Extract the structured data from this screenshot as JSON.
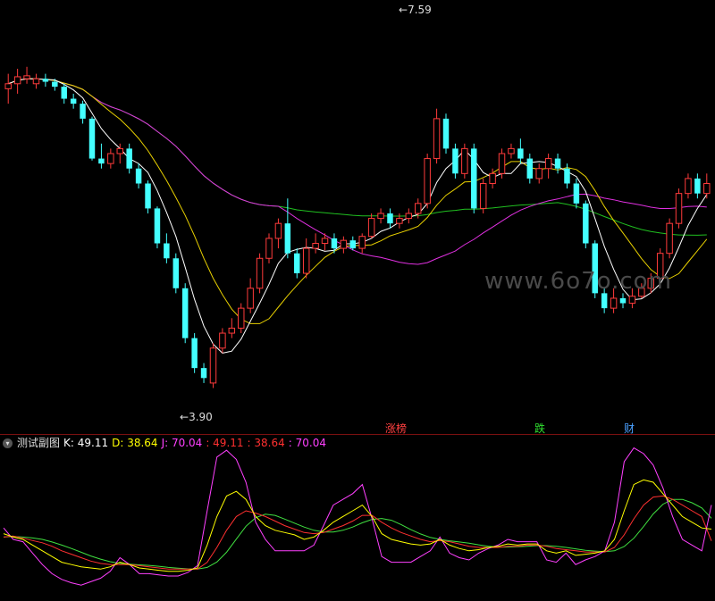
{
  "watermark": "www.6o7o.com",
  "price_labels": {
    "high": "7.59",
    "low": "3.90"
  },
  "tags": [
    {
      "text": "涨榜",
      "color": "#ff4040"
    },
    {
      "text": "跌",
      "color": "#30e030"
    },
    {
      "text": "财",
      "color": "#4aa0ff"
    }
  ],
  "legend": {
    "indicator_name": "测试副图",
    "k_text": "K: 49.11",
    "d_text": "D: 38.64",
    "j_text": "J: 70.04",
    "v1": ": 49.11",
    "v2": ": 38.64",
    "v3": ": 70.04"
  },
  "colors": {
    "up": "#ff3b3b",
    "down": "#44ffff",
    "ma_white": "#ffffff",
    "ma_yellow": "#e8d000",
    "ma_magenta": "#e030e0",
    "ma_green": "#20c020",
    "k_color": "#ffffff",
    "d_color": "#ffff00",
    "j_color": "#ff40ff",
    "v1_color": "#ff3030",
    "v2_color": "#ff3030",
    "v3_color": "#ff40ff"
  },
  "chart_data": [
    {
      "type": "candlestick",
      "title": "",
      "ylim": [
        3.6,
        7.7
      ],
      "annotations": [
        {
          "text": "7.59",
          "value": 7.59
        },
        {
          "text": "3.90",
          "value": 3.9
        }
      ],
      "candles": [
        [
          6.9,
          6.95,
          7.05,
          6.75
        ],
        [
          6.95,
          7.02,
          7.1,
          6.85
        ],
        [
          7.0,
          7.03,
          7.12,
          6.95
        ],
        [
          6.95,
          7.0,
          7.05,
          6.9
        ],
        [
          7.0,
          6.97,
          7.05,
          6.92
        ],
        [
          6.97,
          6.92,
          7.0,
          6.88
        ],
        [
          6.92,
          6.8,
          6.95,
          6.75
        ],
        [
          6.8,
          6.75,
          6.85,
          6.7
        ],
        [
          6.75,
          6.6,
          6.78,
          6.55
        ],
        [
          6.6,
          6.2,
          6.62,
          6.18
        ],
        [
          6.2,
          6.15,
          6.35,
          6.1
        ],
        [
          6.15,
          6.25,
          6.3,
          6.1
        ],
        [
          6.25,
          6.3,
          6.35,
          6.15
        ],
        [
          6.3,
          6.1,
          6.35,
          6.05
        ],
        [
          6.1,
          5.95,
          6.15,
          5.9
        ],
        [
          5.95,
          5.7,
          5.98,
          5.65
        ],
        [
          5.7,
          5.35,
          5.72,
          5.3
        ],
        [
          5.35,
          5.2,
          5.45,
          5.15
        ],
        [
          5.2,
          4.9,
          5.25,
          4.85
        ],
        [
          4.9,
          4.4,
          4.95,
          4.35
        ],
        [
          4.4,
          4.1,
          4.45,
          4.05
        ],
        [
          4.1,
          4.0,
          4.15,
          3.95
        ],
        [
          3.95,
          4.3,
          4.35,
          3.9
        ],
        [
          4.3,
          4.45,
          4.5,
          4.25
        ],
        [
          4.45,
          4.5,
          4.6,
          4.4
        ],
        [
          4.5,
          4.7,
          4.75,
          4.45
        ],
        [
          4.7,
          4.9,
          5.0,
          4.65
        ],
        [
          4.9,
          5.2,
          5.25,
          4.85
        ],
        [
          5.2,
          5.4,
          5.45,
          5.15
        ],
        [
          5.4,
          5.55,
          5.6,
          5.3
        ],
        [
          5.55,
          5.25,
          5.8,
          5.2
        ],
        [
          5.25,
          5.05,
          5.3,
          5.0
        ],
        [
          5.05,
          5.3,
          5.4,
          5.0
        ],
        [
          5.3,
          5.35,
          5.45,
          5.25
        ],
        [
          5.35,
          5.4,
          5.45,
          5.28
        ],
        [
          5.4,
          5.3,
          5.45,
          5.25
        ],
        [
          5.3,
          5.38,
          5.42,
          5.25
        ],
        [
          5.38,
          5.3,
          5.42,
          5.28
        ],
        [
          5.3,
          5.42,
          5.45,
          5.25
        ],
        [
          5.42,
          5.6,
          5.65,
          5.4
        ],
        [
          5.6,
          5.65,
          5.7,
          5.55
        ],
        [
          5.65,
          5.55,
          5.7,
          5.5
        ],
        [
          5.55,
          5.6,
          5.65,
          5.5
        ],
        [
          5.6,
          5.65,
          5.7,
          5.55
        ],
        [
          5.65,
          5.75,
          5.8,
          5.6
        ],
        [
          5.75,
          6.2,
          6.25,
          5.7
        ],
        [
          6.2,
          6.6,
          6.7,
          6.15
        ],
        [
          6.6,
          6.3,
          6.65,
          6.25
        ],
        [
          6.3,
          6.05,
          6.35,
          6.0
        ],
        [
          6.05,
          6.3,
          6.35,
          6.0
        ],
        [
          6.3,
          5.7,
          6.35,
          5.65
        ],
        [
          5.7,
          5.95,
          6.0,
          5.65
        ],
        [
          5.95,
          6.05,
          6.1,
          5.9
        ],
        [
          6.05,
          6.25,
          6.3,
          6.0
        ],
        [
          6.25,
          6.3,
          6.35,
          6.2
        ],
        [
          6.3,
          6.2,
          6.4,
          6.15
        ],
        [
          6.2,
          6.0,
          6.25,
          5.95
        ],
        [
          6.0,
          6.1,
          6.15,
          5.95
        ],
        [
          6.1,
          6.2,
          6.25,
          6.0
        ],
        [
          6.2,
          6.1,
          6.25,
          6.05
        ],
        [
          6.1,
          5.95,
          6.15,
          5.9
        ],
        [
          5.95,
          5.75,
          6.0,
          5.7
        ],
        [
          5.75,
          5.35,
          5.78,
          5.3
        ],
        [
          5.35,
          4.85,
          5.38,
          4.8
        ],
        [
          4.85,
          4.7,
          4.9,
          4.65
        ],
        [
          4.7,
          4.8,
          4.9,
          4.65
        ],
        [
          4.8,
          4.75,
          4.85,
          4.7
        ],
        [
          4.75,
          4.82,
          4.9,
          4.7
        ],
        [
          4.82,
          4.9,
          4.95,
          4.8
        ],
        [
          4.9,
          5.0,
          5.05,
          4.85
        ],
        [
          5.0,
          5.25,
          5.3,
          4.95
        ],
        [
          5.25,
          5.55,
          5.6,
          5.2
        ],
        [
          5.55,
          5.85,
          5.9,
          5.5
        ],
        [
          5.85,
          6.0,
          6.05,
          5.8
        ],
        [
          6.0,
          5.85,
          6.05,
          5.8
        ],
        [
          5.85,
          5.95,
          6.05,
          5.8
        ]
      ]
    },
    {
      "type": "line",
      "title": "测试副图",
      "ylim": [
        -10,
        115
      ],
      "series": [
        {
          "name": "K",
          "values": [
            45,
            42,
            40,
            35,
            30,
            25,
            20,
            18,
            16,
            15,
            14,
            16,
            20,
            18,
            15,
            14,
            13,
            12,
            12,
            13,
            15,
            35,
            60,
            78,
            82,
            75,
            60,
            52,
            48,
            46,
            44,
            40,
            42,
            48,
            55,
            60,
            65,
            70,
            60,
            45,
            40,
            38,
            36,
            35,
            36,
            40,
            35,
            32,
            30,
            31,
            33,
            34,
            36,
            35,
            36,
            36,
            30,
            28,
            30,
            26,
            27,
            28,
            30,
            40,
            65,
            88,
            92,
            90,
            80,
            70,
            60,
            55,
            50,
            49
          ]
        },
        {
          "name": "D",
          "values": [
            42,
            43,
            41,
            39,
            37,
            34,
            30,
            27,
            24,
            21,
            19,
            18,
            18,
            18,
            17,
            16,
            15,
            14,
            14,
            14,
            14,
            20,
            33,
            48,
            60,
            65,
            63,
            60,
            56,
            52,
            49,
            46,
            45,
            46,
            49,
            52,
            56,
            61,
            61,
            55,
            50,
            46,
            43,
            40,
            38,
            39,
            38,
            36,
            34,
            33,
            33,
            33,
            34,
            34,
            35,
            35,
            34,
            32,
            31,
            30,
            29,
            29,
            29,
            33,
            44,
            58,
            70,
            77,
            78,
            75,
            70,
            65,
            60,
            38.64
          ]
        },
        {
          "name": "J",
          "values": [
            50,
            40,
            38,
            28,
            18,
            10,
            5,
            2,
            0,
            3,
            6,
            12,
            24,
            18,
            10,
            10,
            9,
            8,
            8,
            11,
            17,
            65,
            112,
            118,
            110,
            90,
            55,
            40,
            30,
            30,
            30,
            30,
            35,
            52,
            70,
            75,
            80,
            88,
            58,
            25,
            20,
            20,
            20,
            25,
            30,
            42,
            28,
            24,
            22,
            28,
            32,
            35,
            40,
            38,
            38,
            38,
            22,
            20,
            28,
            18,
            22,
            25,
            30,
            55,
            108,
            120,
            115,
            105,
            85,
            60,
            40,
            35,
            30,
            70.04
          ]
        }
      ]
    }
  ]
}
